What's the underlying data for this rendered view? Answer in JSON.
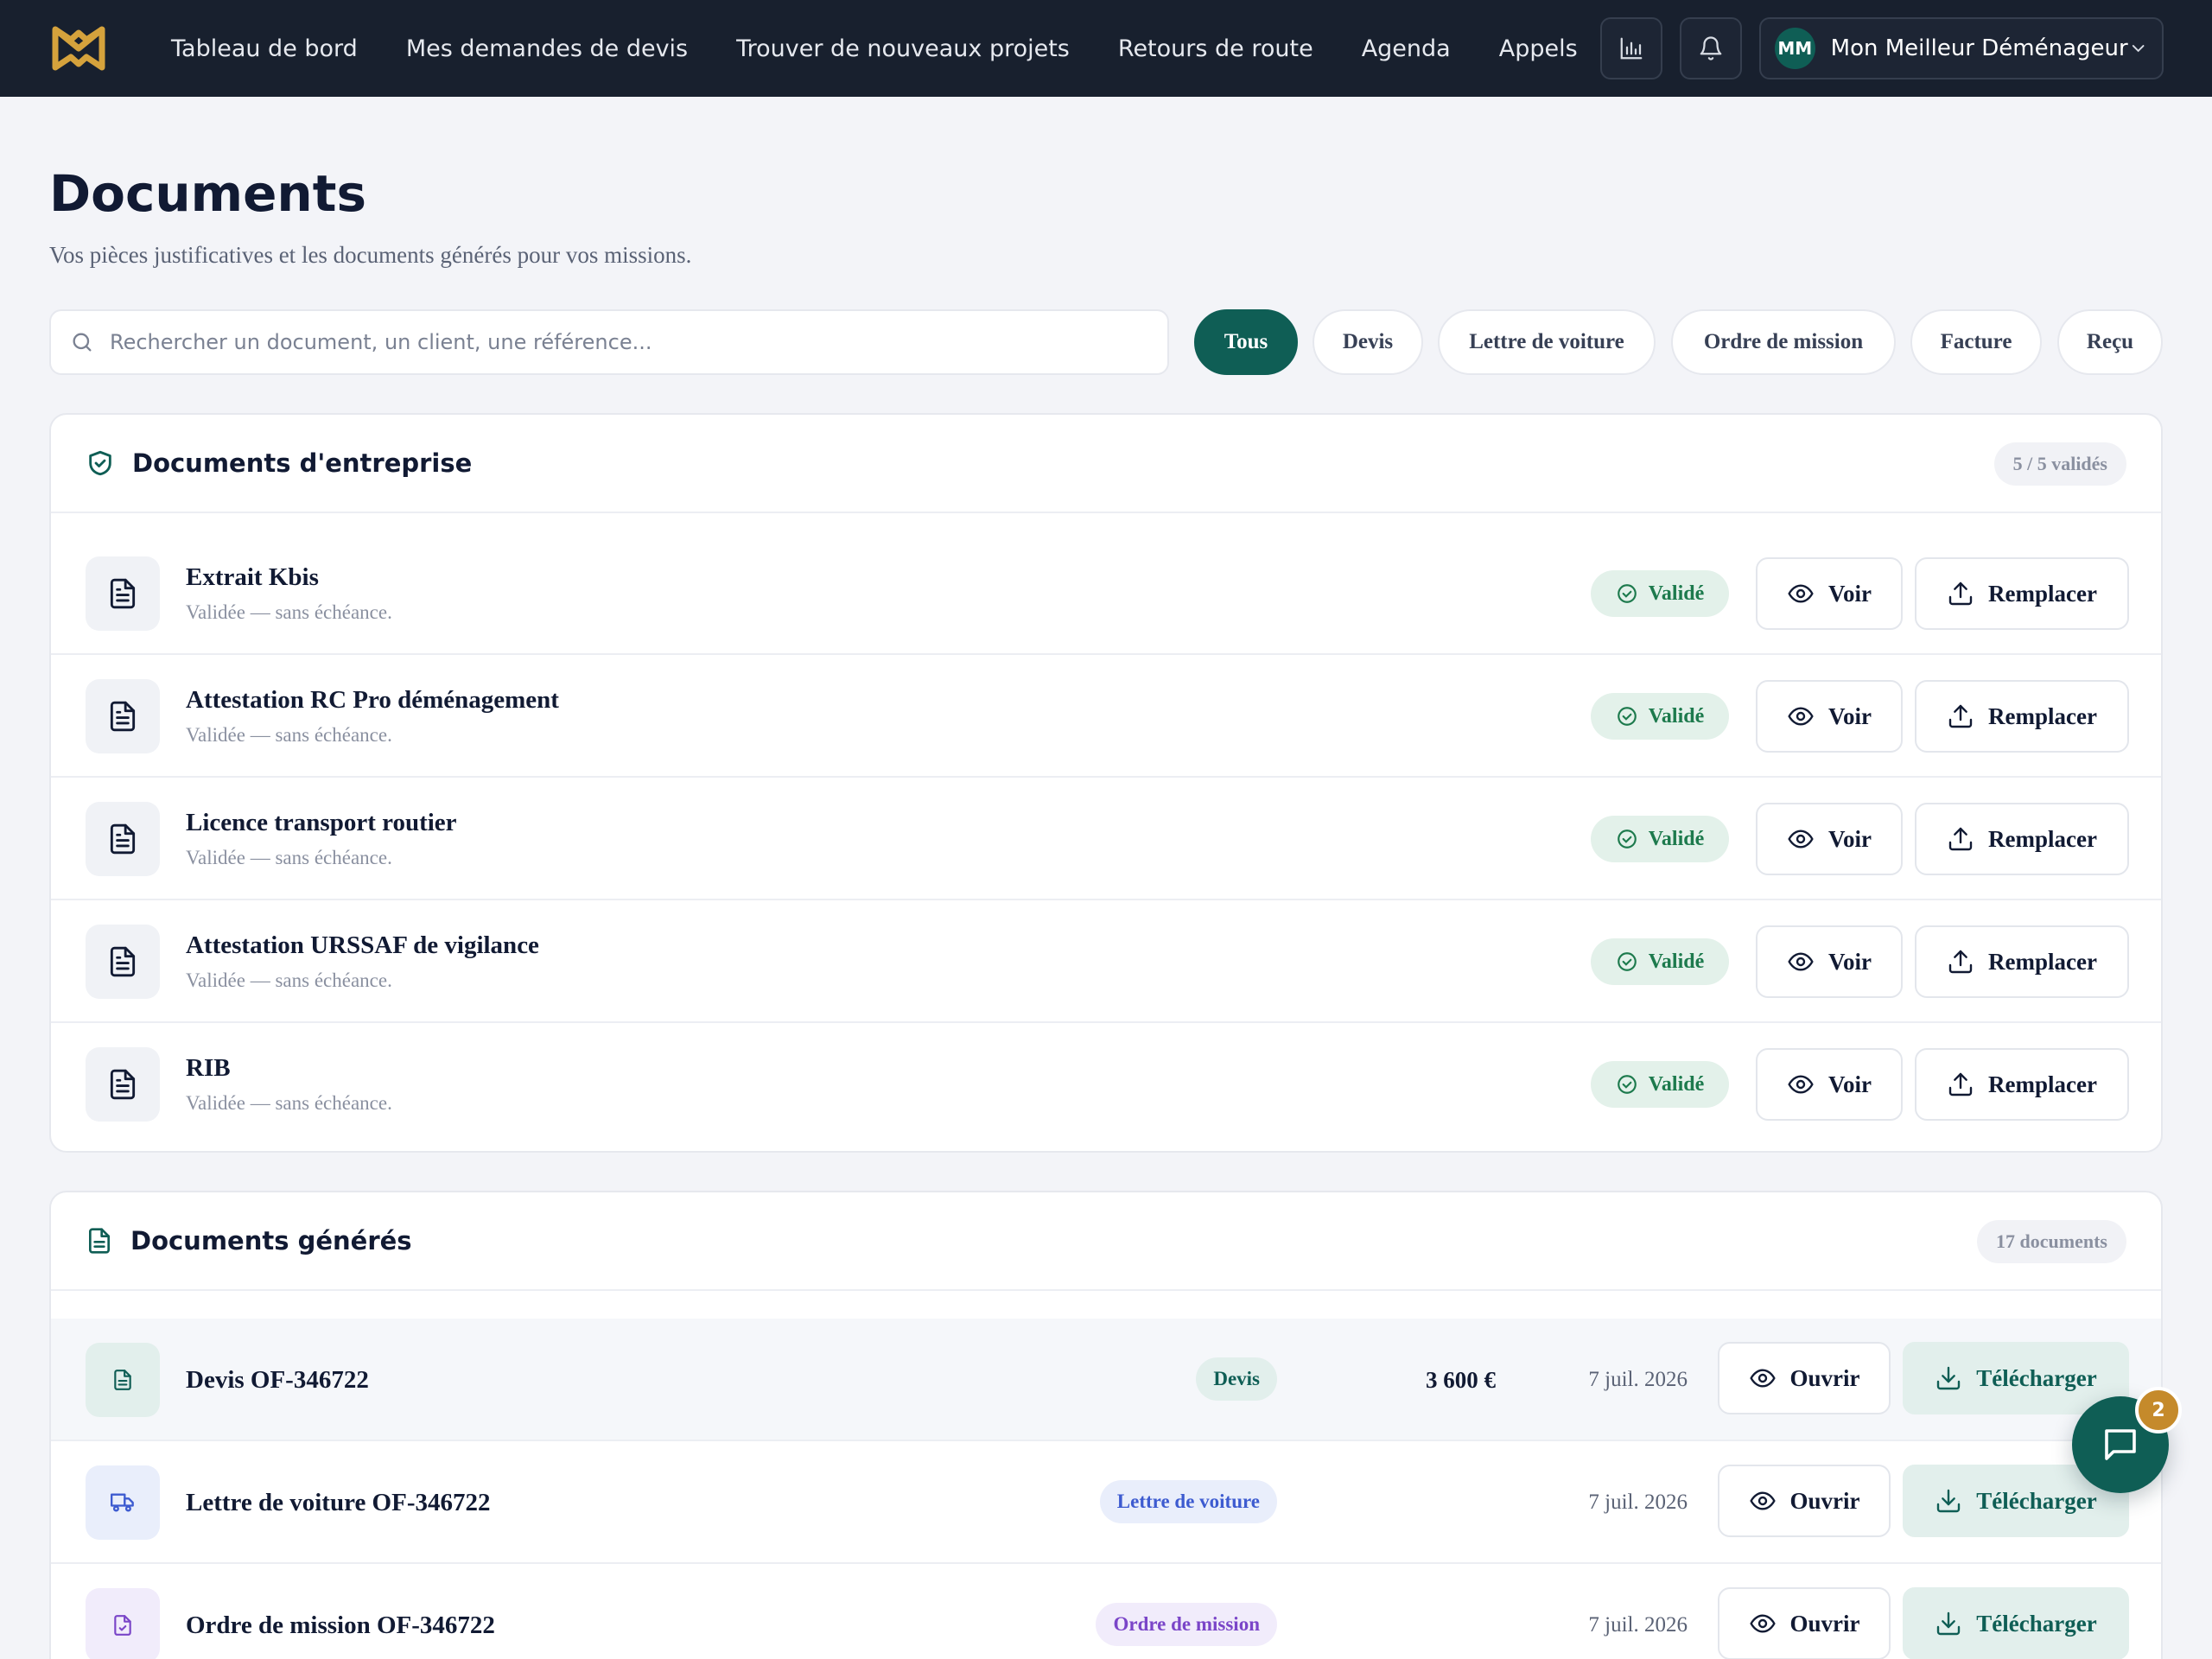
{
  "nav": {
    "links": [
      "Tableau de bord",
      "Mes demandes de devis",
      "Trouver de nouveaux projets",
      "Retours de route",
      "Agenda",
      "Appels"
    ],
    "account_initials": "MM",
    "account_name": "Mon Meilleur Déménageur",
    "brand_colors": {
      "bar": "#18202e",
      "logo": "#d5a23c",
      "accent": "#0f5e55"
    }
  },
  "header": {
    "title": "Documents",
    "subtitle": "Vos pièces justificatives et les documents générés pour vos missions."
  },
  "search": {
    "placeholder": "Rechercher un document, un client, une référence..."
  },
  "filters": [
    "Tous",
    "Devis",
    "Lettre de voiture",
    "Ordre de mission",
    "Facture",
    "Reçu"
  ],
  "active_filter": "Tous",
  "company": {
    "title": "Documents d'entreprise",
    "count": "5 / 5 validés",
    "status_label": "Validé",
    "view_label": "Voir",
    "replace_label": "Remplacer",
    "items": [
      {
        "name": "Extrait Kbis",
        "meta": "Validée — sans échéance."
      },
      {
        "name": "Attestation RC Pro déménagement",
        "meta": "Validée — sans échéance."
      },
      {
        "name": "Licence transport routier",
        "meta": "Validée — sans échéance."
      },
      {
        "name": "Attestation URSSAF de vigilance",
        "meta": "Validée — sans échéance."
      },
      {
        "name": "RIB",
        "meta": "Validée — sans échéance."
      }
    ]
  },
  "generated": {
    "title": "Documents générés",
    "count": "17 documents",
    "open_label": "Ouvrir",
    "download_label": "Télécharger",
    "items": [
      {
        "name": "Devis OF-346722",
        "tag": "Devis",
        "amount": "3 600 €",
        "date": "7 juil. 2026",
        "icon": "file-icon"
      },
      {
        "name": "Lettre de voiture OF-346722",
        "tag": "Lettre de voiture",
        "amount": "",
        "date": "7 juil. 2026",
        "icon": "truck-icon"
      },
      {
        "name": "Ordre de mission OF-346722",
        "tag": "Ordre de mission",
        "amount": "",
        "date": "7 juil. 2026",
        "icon": "file-check-icon"
      }
    ]
  },
  "chat": {
    "badge": "2"
  }
}
